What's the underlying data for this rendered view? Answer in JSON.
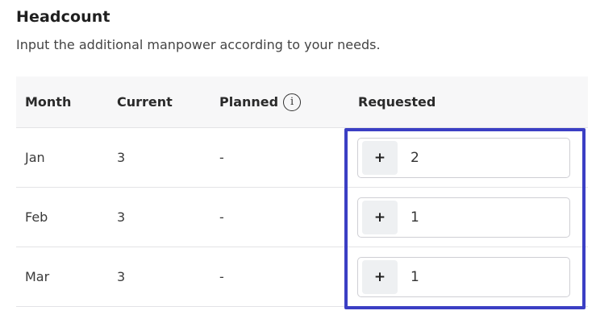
{
  "header": {
    "title": "Headcount",
    "subtitle": "Input the additional manpower according to your needs."
  },
  "table": {
    "columns": {
      "month": "Month",
      "current": "Current",
      "planned": "Planned",
      "requested": "Requested"
    },
    "info_icon_glyph": "i",
    "rows": [
      {
        "month": "Jan",
        "current": "3",
        "planned": "-",
        "plus": "+",
        "requested": "2"
      },
      {
        "month": "Feb",
        "current": "3",
        "planned": "-",
        "plus": "+",
        "requested": "1"
      },
      {
        "month": "Mar",
        "current": "3",
        "planned": "-",
        "plus": "+",
        "requested": "1"
      }
    ]
  },
  "colors": {
    "highlight_border": "#3b3fc4",
    "header_bg": "#f7f7f8",
    "stepper_button_bg": "#eef0f2"
  },
  "icons": {
    "planned_info": "info-icon"
  }
}
